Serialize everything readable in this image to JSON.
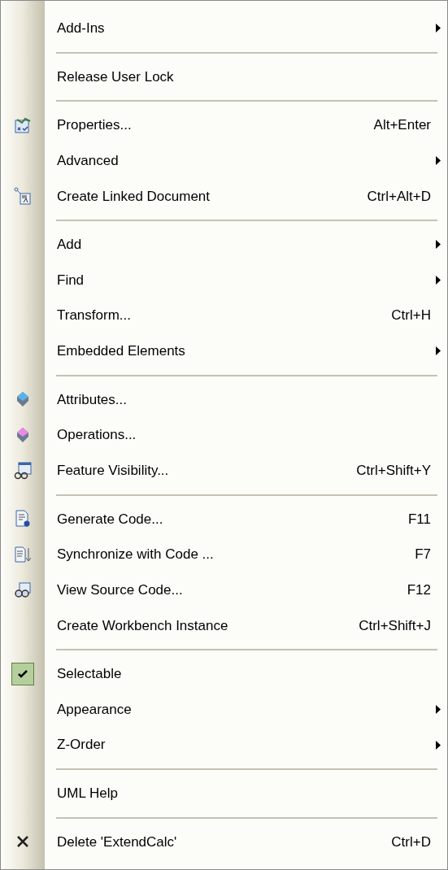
{
  "menu": [
    {
      "kind": "item",
      "label": "Add-Ins",
      "submenu": true,
      "checked": false
    },
    {
      "kind": "separator"
    },
    {
      "kind": "item",
      "label": "Release User Lock",
      "submenu": false,
      "checked": false
    },
    {
      "kind": "separator"
    },
    {
      "kind": "item",
      "label": "Properties...",
      "shortcut": "Alt+Enter",
      "submenu": false,
      "checked": false
    },
    {
      "kind": "item",
      "label": "Advanced",
      "submenu": true,
      "checked": false
    },
    {
      "kind": "item",
      "label": "Create Linked Document",
      "shortcut": "Ctrl+Alt+D",
      "submenu": false,
      "checked": false
    },
    {
      "kind": "separator"
    },
    {
      "kind": "item",
      "label": "Add",
      "submenu": true,
      "checked": false
    },
    {
      "kind": "item",
      "label": "Find",
      "submenu": true,
      "checked": false
    },
    {
      "kind": "item",
      "label": "Transform...",
      "shortcut": "Ctrl+H",
      "submenu": false,
      "checked": false
    },
    {
      "kind": "item",
      "label": "Embedded Elements",
      "submenu": true,
      "checked": false
    },
    {
      "kind": "separator"
    },
    {
      "kind": "item",
      "label": "Attributes...",
      "submenu": false,
      "checked": false
    },
    {
      "kind": "item",
      "label": "Operations...",
      "submenu": false,
      "checked": false
    },
    {
      "kind": "item",
      "label": "Feature Visibility...",
      "shortcut": "Ctrl+Shift+Y",
      "submenu": false,
      "checked": false
    },
    {
      "kind": "separator"
    },
    {
      "kind": "item",
      "label": "Generate Code...",
      "shortcut": "F11",
      "submenu": false,
      "checked": false
    },
    {
      "kind": "item",
      "label": "Synchronize with Code ...",
      "shortcut": "F7",
      "submenu": false,
      "checked": false
    },
    {
      "kind": "item",
      "label": "View Source Code...",
      "shortcut": "F12",
      "submenu": false,
      "checked": false
    },
    {
      "kind": "item",
      "label": "Create Workbench Instance",
      "shortcut": "Ctrl+Shift+J",
      "submenu": false,
      "checked": false
    },
    {
      "kind": "separator"
    },
    {
      "kind": "item",
      "label": "Selectable",
      "submenu": false,
      "checked": true
    },
    {
      "kind": "item",
      "label": "Appearance",
      "submenu": true,
      "checked": false
    },
    {
      "kind": "item",
      "label": "Z-Order",
      "submenu": true,
      "checked": false
    },
    {
      "kind": "separator"
    },
    {
      "kind": "item",
      "label": "UML Help",
      "submenu": false,
      "checked": false
    },
    {
      "kind": "separator"
    },
    {
      "kind": "item",
      "label": "Delete 'ExtendCalc'",
      "shortcut": "Ctrl+D",
      "submenu": false,
      "checked": false
    }
  ]
}
